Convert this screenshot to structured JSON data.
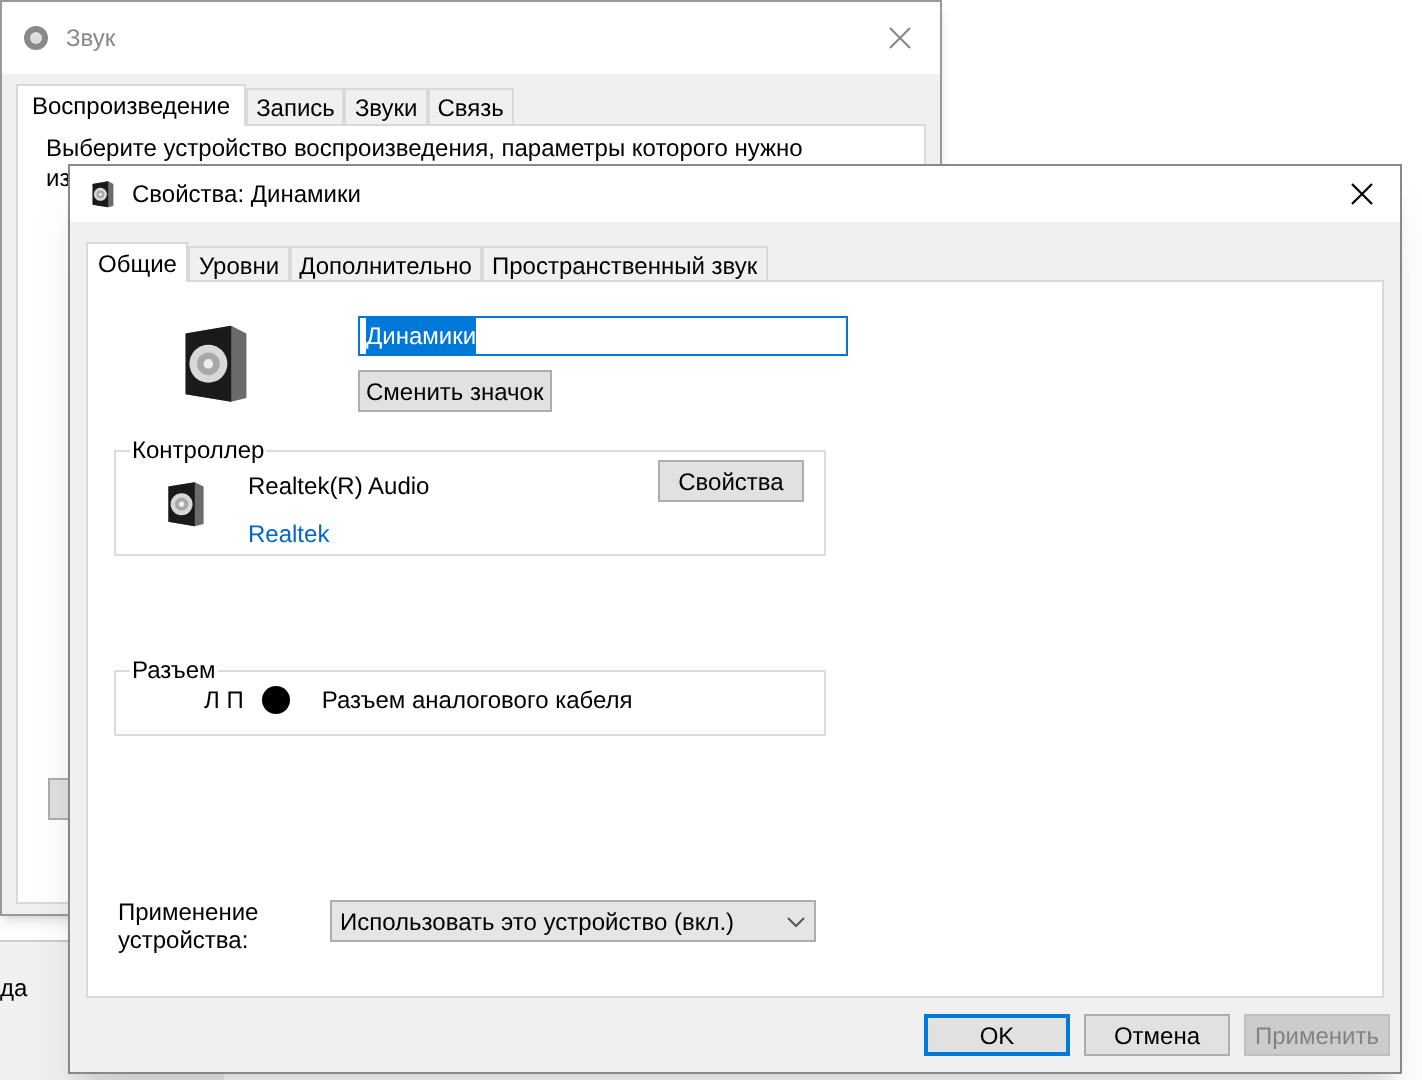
{
  "background_window_2": {
    "text": "да"
  },
  "background_window": {
    "title": "Звук",
    "tabs": [
      {
        "label": "Воспроизведение",
        "selected": true
      },
      {
        "label": "Запись",
        "selected": false
      },
      {
        "label": "Звуки",
        "selected": false
      },
      {
        "label": "Связь",
        "selected": false
      }
    ],
    "description_line_1": "Выберите устройство воспроизведения, параметры которого нужно",
    "description_line_2": "из"
  },
  "dialog": {
    "title": "Свойства: Динамики",
    "tabs": [
      {
        "label": "Общие",
        "selected": true
      },
      {
        "label": "Уровни",
        "selected": false
      },
      {
        "label": "Дополнительно",
        "selected": false
      },
      {
        "label": "Пространственный звук",
        "selected": false
      }
    ],
    "name_field": {
      "value": "Динамики"
    },
    "change_icon_button": "Сменить значок",
    "controller": {
      "legend": "Контроллер",
      "name": "Realtek(R) Audio",
      "link": "Realtek",
      "button": "Свойства"
    },
    "jack": {
      "legend": "Разъем",
      "channels": "Л П",
      "color": "#000000",
      "description": "Разъем аналогового кабеля"
    },
    "device_usage": {
      "label": "Применение устройства:",
      "value": "Использовать это устройство (вкл.)"
    },
    "buttons": [
      {
        "label": "OK",
        "kind": "default",
        "disabled": false
      },
      {
        "label": "Отмена",
        "kind": "normal",
        "disabled": false
      },
      {
        "label": "Применить",
        "kind": "normal",
        "disabled": true
      }
    ]
  }
}
